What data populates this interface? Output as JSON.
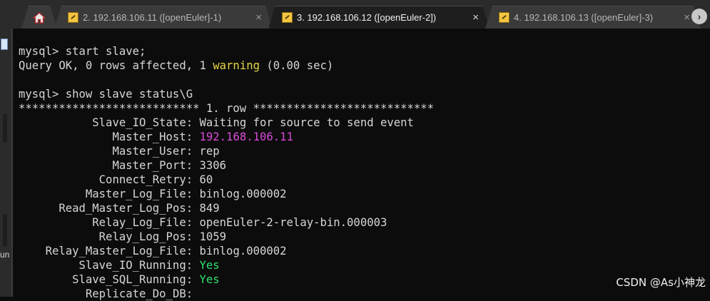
{
  "tabs": [
    {
      "label": "2. 192.168.106.11 ([openEuler]-1)",
      "close": "×"
    },
    {
      "label": "3. 192.168.106.12 ([openEuler-2])",
      "close": "×"
    },
    {
      "label": "4. 192.168.106.13 ([openEuler]-3)",
      "close": "×"
    }
  ],
  "tabbar": {
    "scroll_right": "›"
  },
  "sidebar": {
    "fragment": "un"
  },
  "terminal": {
    "prompt": "mysql> ",
    "cmd1": "start slave;",
    "resp_prefix": "Query OK, 0 rows affected, 1 ",
    "resp_warning": "warning",
    "resp_suffix": " (0.00 sec)",
    "cmd2": "show slave status\\G",
    "row_header": "*************************** 1. row ***************************",
    "fields": [
      {
        "key": "Slave_IO_State",
        "value": "Waiting for source to send event",
        "style": "normal"
      },
      {
        "key": "Master_Host",
        "value": "192.168.106.11",
        "style": "ip"
      },
      {
        "key": "Master_User",
        "value": "rep",
        "style": "normal"
      },
      {
        "key": "Master_Port",
        "value": "3306",
        "style": "normal"
      },
      {
        "key": "Connect_Retry",
        "value": "60",
        "style": "normal"
      },
      {
        "key": "Master_Log_File",
        "value": "binlog.000002",
        "style": "normal"
      },
      {
        "key": "Read_Master_Log_Pos",
        "value": "849",
        "style": "normal"
      },
      {
        "key": "Relay_Log_File",
        "value": "openEuler-2-relay-bin.000003",
        "style": "normal"
      },
      {
        "key": "Relay_Log_Pos",
        "value": "1059",
        "style": "normal"
      },
      {
        "key": "Relay_Master_Log_File",
        "value": "binlog.000002",
        "style": "normal"
      },
      {
        "key": "Slave_IO_Running",
        "value": "Yes",
        "style": "yes"
      },
      {
        "key": "Slave_SQL_Running",
        "value": "Yes",
        "style": "yes"
      },
      {
        "key": "Replicate_Do_DB",
        "value": "",
        "style": "normal"
      }
    ]
  },
  "watermark": "CSDN @As小神龙",
  "colors": {
    "background": "#0c0c0c",
    "text": "#d6d6d6",
    "warning": "#e5d544",
    "host_ip": "#d94ad8",
    "yes": "#2ee06e"
  }
}
